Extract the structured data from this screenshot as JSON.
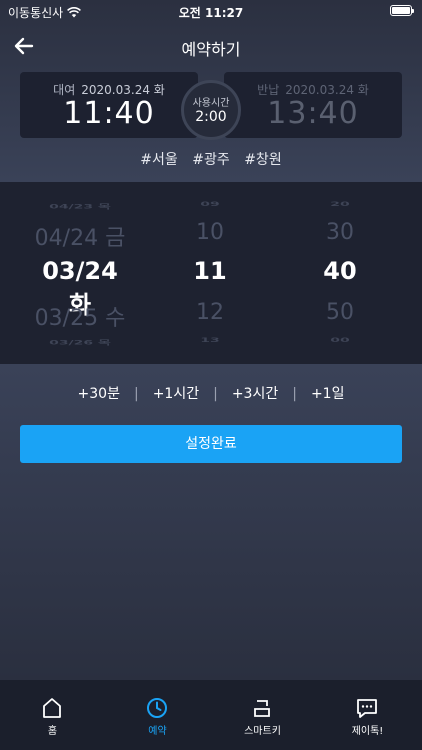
{
  "status": {
    "carrier": "이동통신사",
    "time": "오전 11:27"
  },
  "header": {
    "title": "예약하기"
  },
  "rental": {
    "label": "대여",
    "date": "2020.03.24 화",
    "time": "11:40"
  },
  "usage": {
    "label": "사용시간",
    "value": "2:00"
  },
  "return": {
    "label": "반납",
    "date": "2020.03.24 화",
    "time": "13:40"
  },
  "tags": [
    "#서울",
    "#광주",
    "#창원"
  ],
  "picker": {
    "date": {
      "far_top": "04/23 목",
      "near_top": "04/24 금",
      "selected": "03/24 화",
      "near_bot": "03/25 수",
      "far_bot": "03/26 목"
    },
    "hour": {
      "far_top": "09",
      "near_top": "10",
      "selected": "11",
      "near_bot": "12",
      "far_bot": "13"
    },
    "minute": {
      "far_top": "20",
      "near_top": "30",
      "selected": "40",
      "near_bot": "50",
      "far_bot": "00"
    }
  },
  "quick_add": [
    "+30분",
    "+1시간",
    "+3시간",
    "+1일"
  ],
  "confirm_label": "설정완료",
  "tabs": [
    {
      "label": "홈",
      "icon": "home-icon"
    },
    {
      "label": "예약",
      "icon": "clock-icon"
    },
    {
      "label": "스마트키",
      "icon": "smart-key-icon"
    },
    {
      "label": "제이톡!",
      "icon": "chat-icon"
    }
  ],
  "colors": {
    "accent": "#1aa3f5",
    "background": "#2a2e3d",
    "card": "#1d2130",
    "tabbar": "#1b1f2c"
  }
}
